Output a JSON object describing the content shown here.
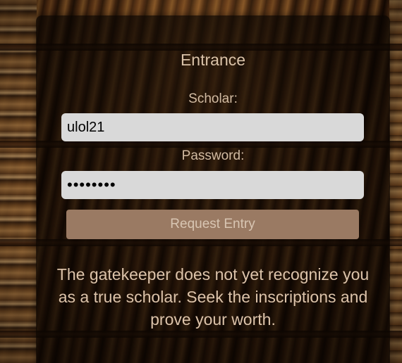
{
  "form": {
    "title": "Entrance",
    "scholar_label": "Scholar:",
    "scholar_value": "ulol21",
    "password_label": "Password:",
    "password_value": "12345678",
    "submit_label": "Request Entry"
  },
  "message": {
    "text": "The gatekeeper does not yet recognize you as a true scholar. Seek the inscriptions and prove your worth."
  },
  "colors": {
    "card_bg": "#080402",
    "button_bg": "#9a7a63",
    "text_accent": "#d9c2a8",
    "input_bg": "#d9d9d9"
  }
}
